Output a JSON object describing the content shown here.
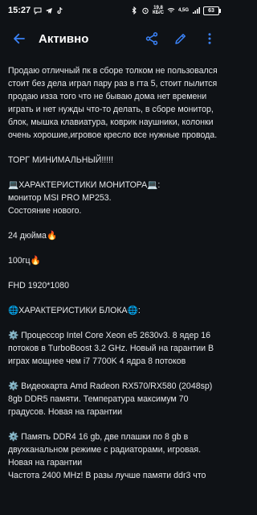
{
  "status": {
    "time": "15:27",
    "network_top": "19,8",
    "network_bottom": "КБ/С",
    "network_type": "4,5G",
    "battery": "63"
  },
  "header": {
    "title": "Активно",
    "back_icon": "arrow-left-icon",
    "share_icon": "share-icon",
    "edit_icon": "pencil-icon",
    "more_icon": "more-vertical-icon",
    "accent": "#3b82f6"
  },
  "description": {
    "paragraphs": [
      "Продаю отличный пк в сборе толком не пользовался стоит без дела играл пару раз в гта 5, стоит пылится продаю изза того что не бываю дома нет времени играть и нет нужды что-то делать, в сборе монитор, блок, мышка клавиатура, коврик наушники, колонки очень хорошие,игровое кресло все нужные провода.",
      "ТОРГ МИНИМАЛЬНЫЙ!!!!!",
      "💻ХАРАКТЕРИСТИКИ МОНИТОРА💻:\nмонитор MSI PRO MP253.\nСостояние нового.",
      "24 дюйма🔥",
      "100гц🔥",
      "FHD 1920*1080",
      "🌐ХАРАКТЕРИСТИКИ БЛОКА🌐:",
      "⚙️ Процессор Intel Core Xeon e5 2630v3. 8 ядер 16 потоков в TurboBoost 3.2 GHz. Новый на гарантии В играх мощнее чем i7 7700K 4 ядра 8 потоков",
      "⚙️ Видеокарта Amd Radeon RX570/RX580 (2048sp) 8gb DDR5 памяти. Температура максимум 70 градусов. Новая на гарантии",
      "⚙️ Память DDR4 16 gb, две плашки по 8 gb в двухканальном режиме с радиаторами, игровая. Новая на гарантии\nЧастота 2400 MHz! В разы лучше памяти ddr3 что"
    ]
  }
}
